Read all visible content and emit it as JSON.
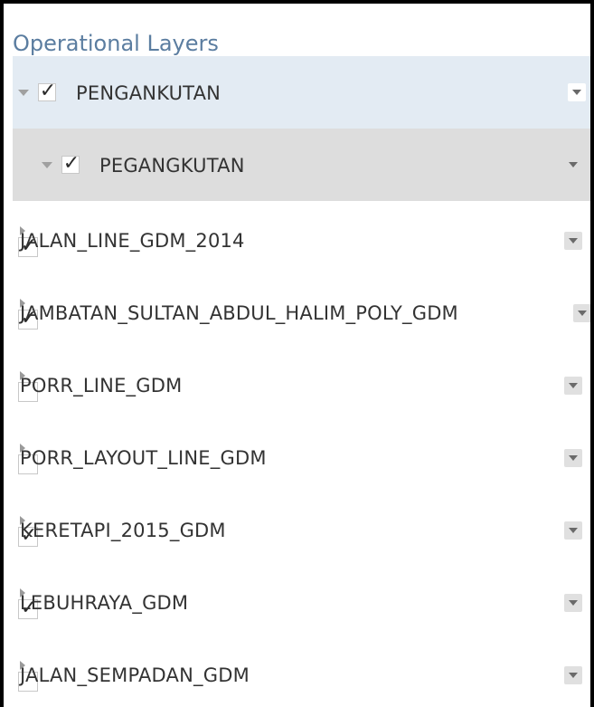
{
  "panel": {
    "title": "Operational Layers"
  },
  "groups": [
    {
      "label": "PENGANKUTAN",
      "checked": true
    },
    {
      "label": "PEGANGKUTAN",
      "checked": true
    }
  ],
  "layers": [
    {
      "label": "JALAN_LINE_GDM_2014",
      "checked": true
    },
    {
      "label": "JAMBATAN_SULTAN_ABDUL_HALIM_POLY_GDM",
      "checked": true
    },
    {
      "label": "PORR_LINE_GDM",
      "checked": false
    },
    {
      "label": "PORR_LAYOUT_LINE_GDM",
      "checked": false
    },
    {
      "label": "KERETAPI_2015_GDM",
      "checked": true
    },
    {
      "label": "LEBUHRAYA_GDM",
      "checked": true
    },
    {
      "label": "JALAN_SEMPADAN_GDM",
      "checked": false
    }
  ],
  "colors": {
    "title": "#5b7da0",
    "group_level1_bg": "#e3ebf3",
    "group_level2_bg": "#dddddd"
  }
}
